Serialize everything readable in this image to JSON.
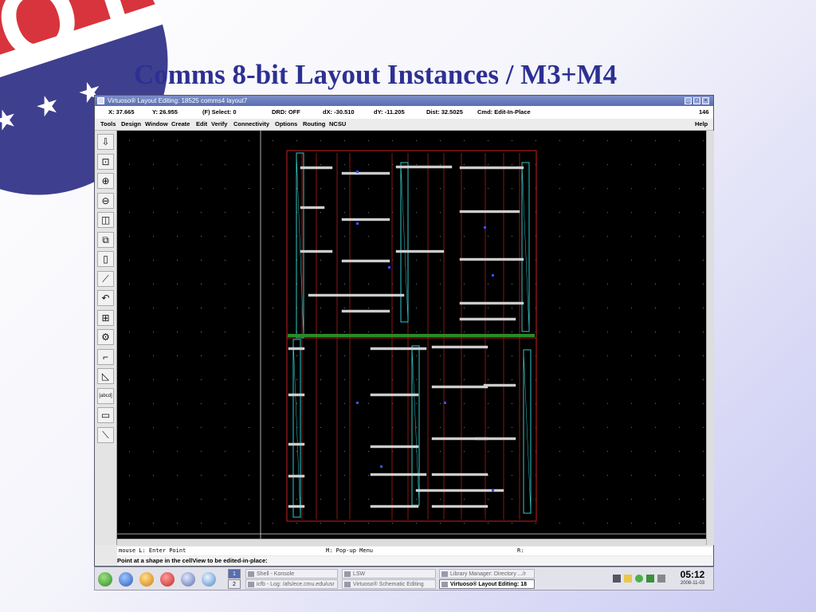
{
  "slide": {
    "title": "Comms 8-bit Layout Instances / M3+M4"
  },
  "badge": {
    "word": "VOTE",
    "stars": "★ ★ ★"
  },
  "window": {
    "title": "Virtuoso® Layout Editing: 18525 comms4 layout7",
    "status": {
      "x": "X: 37.665",
      "y": "Y: 26.955",
      "select": "(F) Select: 0",
      "drd": "DRD: OFF",
      "dx": "dX: -30.510",
      "dy": "dY: -11.205",
      "dist": "Dist: 32.5025",
      "cmd": "Cmd: Edit-In-Place",
      "num": "146"
    },
    "menu": [
      "Tools",
      "Design",
      "Window",
      "Create",
      "Edit",
      "Verify",
      "Connectivity",
      "Options",
      "Routing",
      "NCSU"
    ],
    "help": "Help",
    "toolbar": [
      {
        "icon": "save-icon",
        "glyph": "⇩"
      },
      {
        "icon": "fit-icon",
        "glyph": "⊡"
      },
      {
        "icon": "zoom-in-icon",
        "glyph": "⊕"
      },
      {
        "icon": "zoom-out-icon",
        "glyph": "⊖"
      },
      {
        "icon": "stretch-icon",
        "glyph": "◫"
      },
      {
        "icon": "copy-icon",
        "glyph": "⧉"
      },
      {
        "icon": "move-icon",
        "glyph": "▯"
      },
      {
        "icon": "path-icon",
        "glyph": "⟋"
      },
      {
        "icon": "undo-icon",
        "glyph": "↶"
      },
      {
        "icon": "pins-icon",
        "glyph": "⊞"
      },
      {
        "icon": "instance-icon",
        "glyph": "⚙"
      },
      {
        "icon": "wire-icon",
        "glyph": "⌐"
      },
      {
        "icon": "delete-icon",
        "glyph": "◺"
      },
      {
        "icon": "label-icon",
        "glyph": "[abcd]"
      },
      {
        "icon": "property-icon",
        "glyph": "▭"
      },
      {
        "icon": "ruler-icon",
        "glyph": "⟍"
      }
    ],
    "mouse": {
      "left": "mouse L: Enter Point",
      "middle": "M: Pop-up Menu",
      "right": "R:"
    },
    "prompt": "Point at a shape in the cellView to be edited-in-place:"
  },
  "taskbar": {
    "pages": [
      "1",
      "2"
    ],
    "tasks": [
      {
        "label": "Shell - Konsole",
        "active": false
      },
      {
        "label": "LSW",
        "active": false
      },
      {
        "label": "Library Manager: Directory .../r",
        "active": false
      },
      {
        "label": "icfb - Log: /afs/ece.cmu.edu/usr",
        "active": false
      },
      {
        "label": "Virtuoso® Schematic Editing",
        "active": false
      },
      {
        "label": "Virtuoso® Layout Editing: 18",
        "active": true
      }
    ],
    "clock": {
      "time": "05:12",
      "date": "2008-11-03"
    }
  },
  "colors": {
    "title": "#2d3092",
    "canvas": "#000000",
    "layout_red": "#c81e1e",
    "layout_cyan": "#35c7c7"
  }
}
